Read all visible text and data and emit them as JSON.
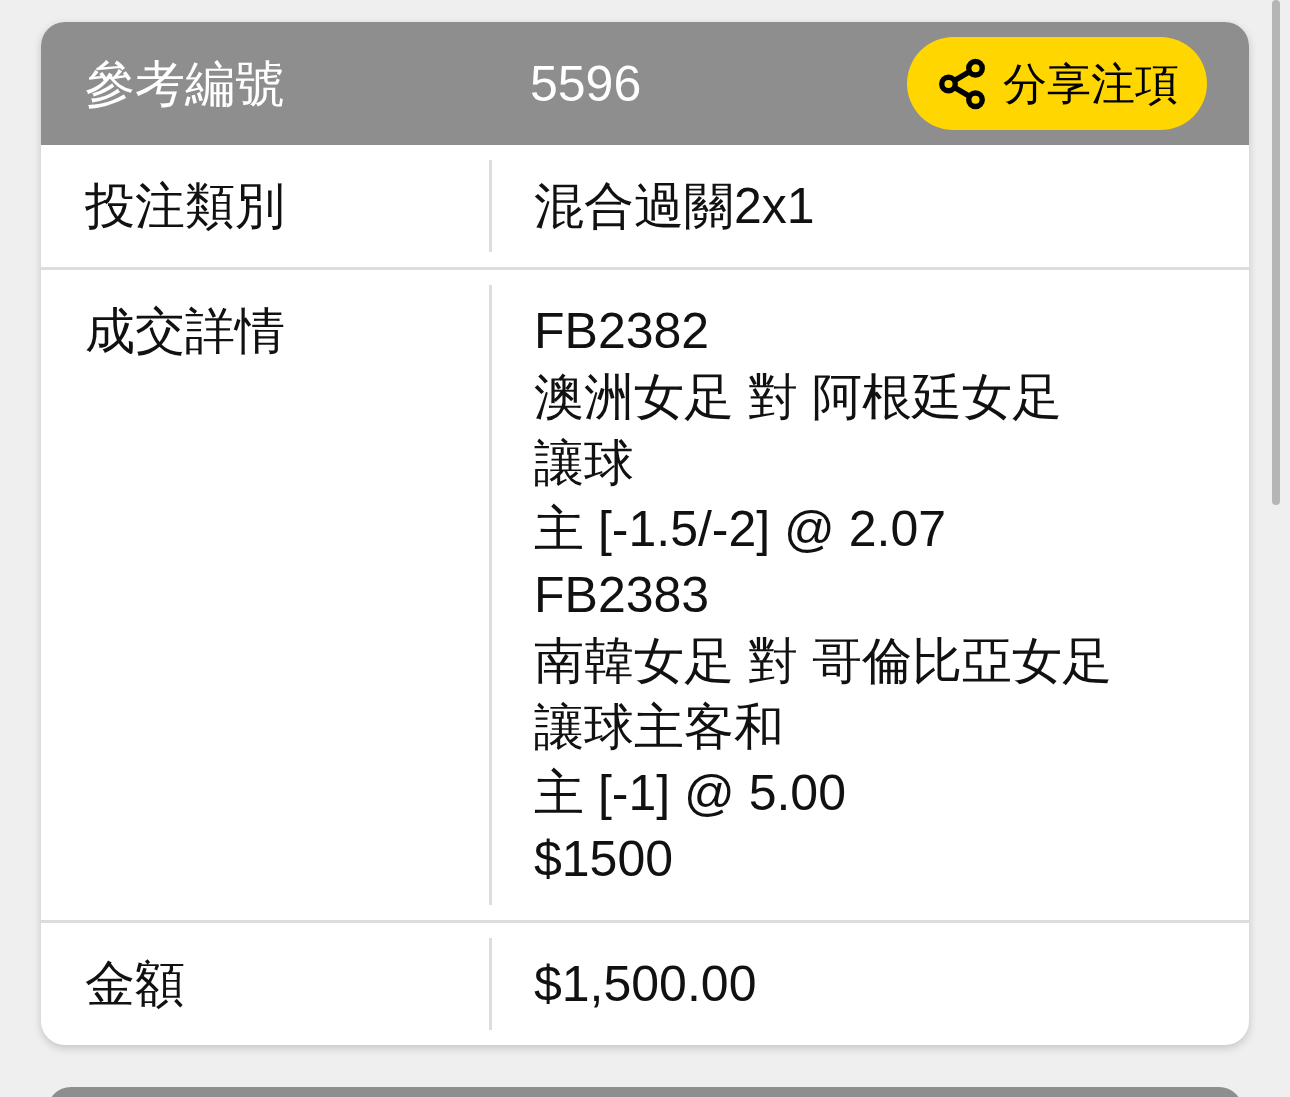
{
  "header": {
    "label": "參考編號",
    "value": "5596",
    "share_button": "分享注項"
  },
  "rows": [
    {
      "label": "投注類別",
      "lines": [
        "混合過關2x1"
      ]
    },
    {
      "label": "成交詳情",
      "lines": [
        "FB2382",
        "澳洲女足 對 阿根廷女足",
        "讓球",
        "主 [-1.5/-2] @ 2.07",
        "FB2383",
        "南韓女足 對 哥倫比亞女足",
        "讓球主客和",
        "主 [-1] @ 5.00",
        "$1500"
      ]
    },
    {
      "label": "金額",
      "lines": [
        "$1,500.00"
      ]
    }
  ]
}
